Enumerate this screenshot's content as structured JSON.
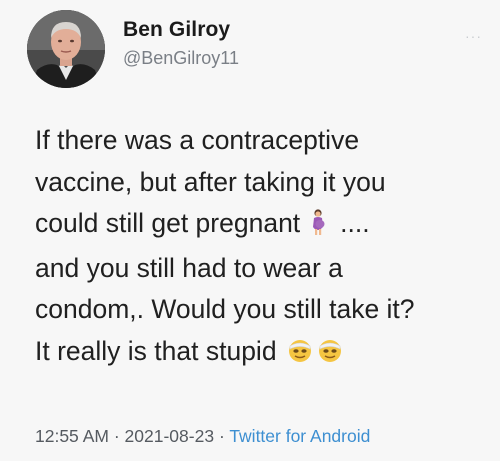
{
  "author": {
    "name": "Ben Gilroy",
    "handle": "@BenGilroy11"
  },
  "tweet": {
    "lines": [
      "If there was a contraceptive",
      "vaccine, but after taking it you",
      "could still get pregnant",
      "and you still had to wear a",
      "condom,. Would you still take it?",
      "It really is that stupid"
    ],
    "line3_suffix": "....",
    "emojis": [
      "pregnant-woman-emoji",
      "face-with-head-bandage-emoji",
      "face-with-head-bandage-emoji"
    ]
  },
  "meta": {
    "time": "12:55 AM",
    "separator": "·",
    "date": "2021-08-23",
    "source": "Twitter for Android"
  },
  "colors": {
    "background": "#f7f7f7",
    "text": "#202020",
    "handle": "#7a7f86",
    "link": "#3d8fd1"
  }
}
